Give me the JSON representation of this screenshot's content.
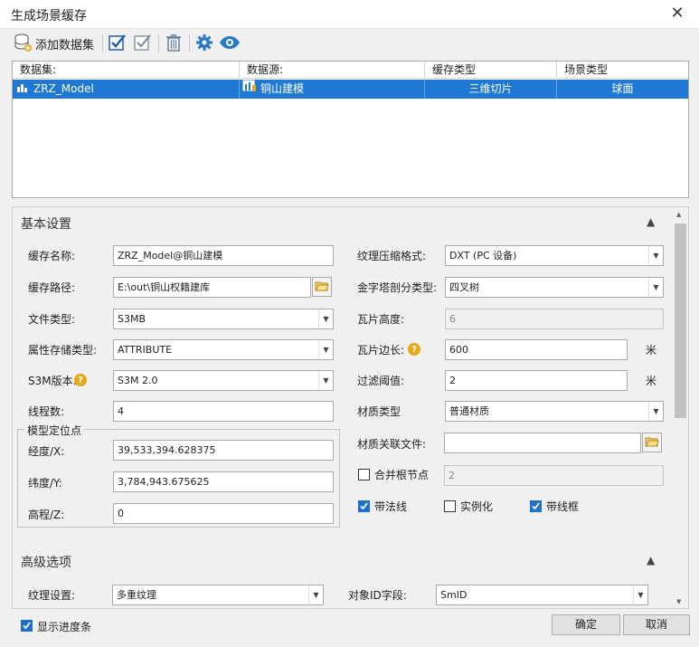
{
  "window": {
    "title": "生成场景缓存"
  },
  "toolbar": {
    "add_dataset": "添加数据集"
  },
  "grid": {
    "headers": [
      "数据集:",
      "数据源:",
      "缓存类型",
      "场景类型"
    ],
    "rows": [
      {
        "dataset": "ZRZ_Model",
        "datasource": "铜山建模",
        "cache_type": "三维切片",
        "scene_type": "球面"
      }
    ]
  },
  "basic": {
    "title": "基本设置",
    "cache_name_label": "缓存名称:",
    "cache_name": "ZRZ_Model@铜山建模",
    "cache_path_label": "缓存路径:",
    "cache_path": "E:\\out\\铜山权籍建库",
    "file_type_label": "文件类型:",
    "file_type": "S3MB",
    "attr_storage_label": "属性存储类型:",
    "attr_storage": "ATTRIBUTE",
    "s3m_version_label": "S3M版本:",
    "s3m_version": "S3M 2.0",
    "threads_label": "线程数:",
    "threads": "4",
    "model_pos_label": "模型定位点",
    "lon_label": "经度/X:",
    "lon": "39,533,394.628375",
    "lat_label": "纬度/Y:",
    "lat": "3,784,943.675625",
    "elev_label": "高程/Z:",
    "elev": "0",
    "texture_label": "纹理压缩格式:",
    "texture": "DXT (PC 设备)",
    "pyramid_label": "金字塔剖分类型:",
    "pyramid": "四叉树",
    "tile_height_label": "瓦片高度:",
    "tile_height": "6",
    "tile_side_label": "瓦片边长:",
    "tile_side": "600",
    "tile_side_unit": "米",
    "filter_label": "过滤阈值:",
    "filter": "2",
    "filter_unit": "米",
    "material_type_label": "材质类型",
    "material_type": "普通材质",
    "material_file_label": "材质关联文件:",
    "material_file": "",
    "merge_root_label": "合并根节点",
    "merge_root": "2",
    "normal_label": "带法线",
    "instance_label": "实例化",
    "wireframe_label": "带线框"
  },
  "advanced": {
    "title": "高级选项",
    "texture_setting_label": "纹理设置:",
    "texture_setting": "多重纹理",
    "object_id_label": "对象ID字段:",
    "object_id": "SmID"
  },
  "footer": {
    "show_progress": "显示进度条",
    "ok": "确定",
    "cancel": "取消"
  },
  "colors": {
    "selection": "#1e78d4",
    "accent_blue": "#1e6fd0",
    "help": "#e6a817"
  }
}
